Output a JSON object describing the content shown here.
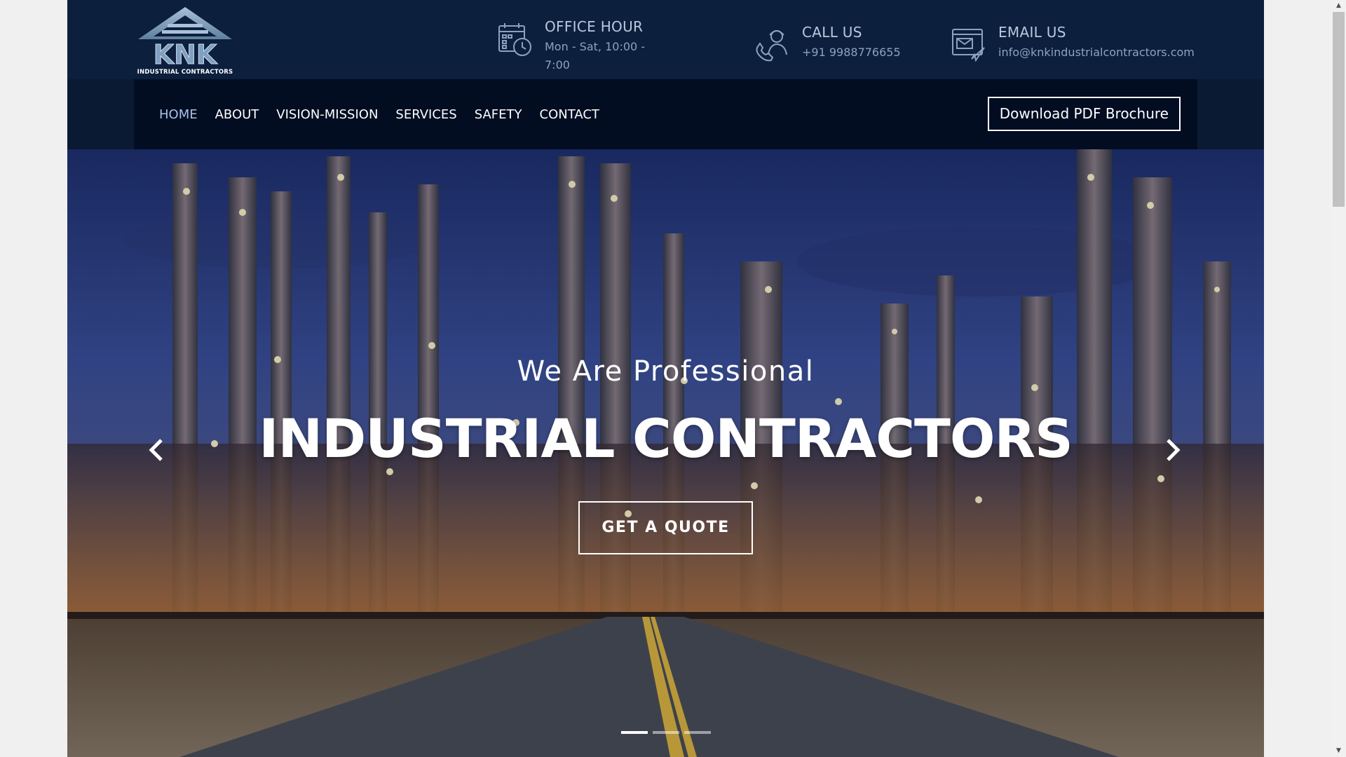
{
  "logo": {
    "caption": "INDUSTRIAL CONTRACTORS"
  },
  "header": {
    "office": {
      "title": "OFFICE HOUR",
      "value": "Mon - Sat, 10:00 - 7:00",
      "icon": "calendar-clock-icon"
    },
    "call": {
      "title": "CALL US",
      "value": "+91 9988776655",
      "icon": "phone-support-icon"
    },
    "email": {
      "title": "EMAIL US",
      "value": "info@knkindustrialcontractors.com",
      "icon": "email-icon"
    }
  },
  "nav": {
    "items": [
      {
        "label": "HOME",
        "active": true
      },
      {
        "label": "ABOUT"
      },
      {
        "label": "VISION-MISSION"
      },
      {
        "label": "SERVICES"
      },
      {
        "label": "SAFETY"
      },
      {
        "label": "CONTACT"
      }
    ],
    "brochure_label": "Download PDF Brochure"
  },
  "hero": {
    "subtitle": "We Are Professional",
    "title": "INDUSTRIAL CONTRACTORS",
    "cta_label": "GET A QUOTE",
    "active_slide": 1,
    "slide_count": 3
  },
  "colors": {
    "header_bg": "#0c1f3d",
    "nav_bg": "#020d22",
    "active_nav": "#a8c2e6"
  }
}
